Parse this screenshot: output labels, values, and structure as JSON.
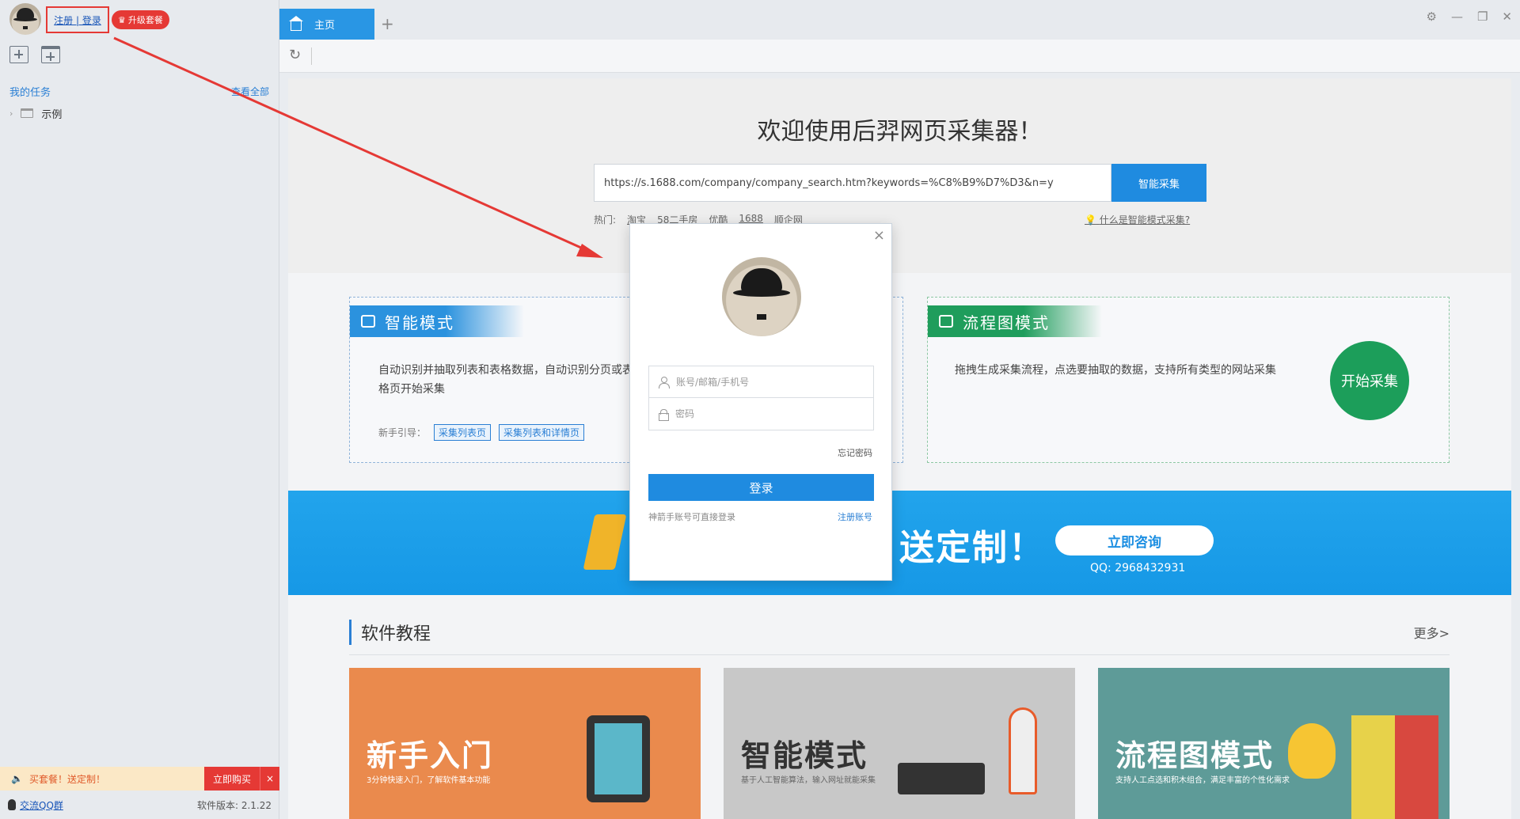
{
  "sidebar": {
    "login_label": "注册 | 登录",
    "upgrade_label": "升级套餐",
    "my_tasks": "我的任务",
    "view_all": "查看全部",
    "tasks": [
      {
        "label": "示例"
      }
    ],
    "promo_text": "买套餐！送定制！",
    "promo_buy": "立即购买",
    "promo_close": "×",
    "qq_group": "交流QQ群",
    "version": "软件版本: 2.1.22"
  },
  "tabs": {
    "home_label": "主页",
    "add": "+"
  },
  "window_controls": {
    "settings": "⚙",
    "minimize": "—",
    "restore": "❐",
    "close": "✕"
  },
  "hero": {
    "title": "欢迎使用后羿网页采集器！",
    "url_value": "https://s.1688.com/company/company_search.htm?keywords=%C8%B9%D7%D3&n=y",
    "url_button": "智能采集",
    "hot_label": "热门:",
    "hot_links": [
      "淘宝",
      "58二手房",
      "优酷",
      "1688",
      "顺企网"
    ],
    "what_link": "什么是智能模式采集?"
  },
  "modes": {
    "smart": {
      "title": "智能模式",
      "desc": "自动识别并抽取列表和表格数据，自动识别分页或表格页开始采集",
      "guide_label": "新手引导：",
      "guide_tags": [
        "采集列表页",
        "采集列表和详情页"
      ]
    },
    "flow": {
      "title": "流程图模式",
      "desc": "拖拽生成采集流程，点选要抽取的数据，支持所有类型的网站采集",
      "start_button": "开始采集"
    }
  },
  "banner": {
    "text": "送定制！",
    "consult_button": "立即咨询",
    "qq": "QQ: 2968432931"
  },
  "tutorials": {
    "title": "软件教程",
    "more": "更多>",
    "cards": [
      {
        "title": "新手入门",
        "subtitle": "3分钟快速入门，了解软件基本功能"
      },
      {
        "title": "智能模式",
        "subtitle": "基于人工智能算法，输入网址就能采集"
      },
      {
        "title": "流程图模式",
        "subtitle": "支持人工点选和积木组合，满足丰富的个性化需求"
      }
    ]
  },
  "login_modal": {
    "close": "×",
    "account_placeholder": "账号/邮箱/手机号",
    "password_placeholder": "密码",
    "forgot": "忘记密码",
    "login_button": "登录",
    "note": "神箭手账号可直接登录",
    "register": "注册账号"
  },
  "colors": {
    "accent_blue": "#1f8be0",
    "flow_green": "#1c9e5a",
    "highlight_red": "#e53935"
  }
}
